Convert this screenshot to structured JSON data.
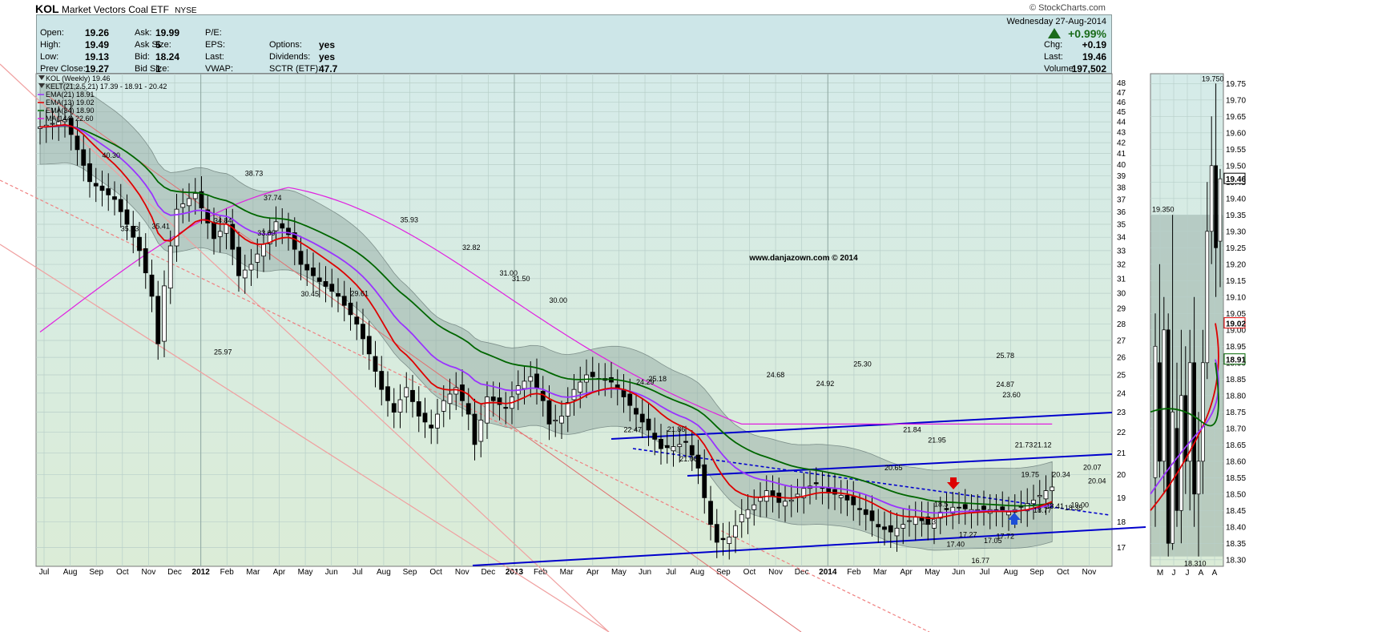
{
  "header": {
    "symbol": "KOL",
    "name": "Market Vectors Coal ETF",
    "exchange": "NYSE",
    "brand": "© StockCharts.com",
    "date": "Wednesday  27-Aug-2014",
    "change_pct": "+0.99%",
    "quote_left": [
      {
        "k": "Open:",
        "v": "19.26"
      },
      {
        "k": "High:",
        "v": "19.49"
      },
      {
        "k": "Low:",
        "v": "19.13"
      },
      {
        "k": "Prev Close:",
        "v": "19.27"
      }
    ],
    "quote_mid": [
      {
        "k": "Ask:",
        "v": "19.99"
      },
      {
        "k": "Ask Size:",
        "v": "5"
      },
      {
        "k": "Bid:",
        "v": "18.24"
      },
      {
        "k": "Bid Size:",
        "v": "1"
      }
    ],
    "quote_mid2": [
      {
        "k": "P/E:",
        "v": ""
      },
      {
        "k": "EPS:",
        "v": ""
      },
      {
        "k": "Last:",
        "v": ""
      },
      {
        "k": "VWAP:",
        "v": ""
      }
    ],
    "quote_right2": [
      {
        "k": "Options:",
        "v": "yes"
      },
      {
        "k": "Dividends:",
        "v": "yes"
      },
      {
        "k": "SCTR (ETF):",
        "v": "47.7"
      }
    ],
    "quote_right": [
      {
        "k": "Chg:",
        "v": "+0.19"
      },
      {
        "k": "Last:",
        "v": "19.46"
      },
      {
        "k": "Volume:",
        "v": "197,502"
      }
    ]
  },
  "legend": [
    {
      "text": "KOL (Weekly) 19.46",
      "color": "#000000"
    },
    {
      "text": "KELT(21,2.5,21) 17.39 - 18.91 - 20.42",
      "color": "#000000"
    },
    {
      "text": "EMA(21) 18.91",
      "color": "#9a33ff"
    },
    {
      "text": "EMA(13) 19.02",
      "color": "#dd0000"
    },
    {
      "text": "EMA(34) 18.90",
      "color": "#006600"
    },
    {
      "text": "MA(144) 22.60",
      "color": "#e020e0"
    }
  ],
  "watermark": "www.danjazown.com © 2014",
  "chart_data": [
    {
      "type": "candlestick",
      "title": "KOL (Weekly)",
      "y_scale": "log",
      "ylim": [
        16.3,
        49
      ],
      "y_ticks": [
        17,
        18,
        19,
        20,
        21,
        22,
        23,
        24,
        25,
        26,
        27,
        28,
        29,
        30,
        31,
        32,
        33,
        34,
        35,
        36,
        37,
        38,
        39,
        40,
        41,
        42,
        43,
        44,
        45,
        46,
        47,
        48
      ],
      "x_ticks": [
        "Jul",
        "Aug",
        "Sep",
        "Oct",
        "Nov",
        "Dec",
        "2012",
        "Feb",
        "Mar",
        "Apr",
        "May",
        "Jun",
        "Jul",
        "Aug",
        "Sep",
        "Oct",
        "Nov",
        "Dec",
        "2013",
        "Feb",
        "Mar",
        "Apr",
        "May",
        "Jun",
        "Jul",
        "Aug",
        "Sep",
        "Oct",
        "Nov",
        "Dec",
        "2014",
        "Feb",
        "Mar",
        "Apr",
        "May",
        "Jun",
        "Jul",
        "Aug",
        "Sep",
        "Oct",
        "Nov"
      ],
      "close_path": [
        [
          0,
          43.5
        ],
        [
          4,
          44.2
        ],
        [
          8,
          38.5
        ],
        [
          12,
          37.0
        ],
        [
          16,
          33.0
        ],
        [
          18,
          29.8
        ],
        [
          19,
          26.8
        ],
        [
          20,
          30.5
        ],
        [
          22,
          36.2
        ],
        [
          25,
          37.5
        ],
        [
          28,
          33.9
        ],
        [
          30,
          35.0
        ],
        [
          32,
          31.2
        ],
        [
          34,
          32.0
        ],
        [
          36,
          33.5
        ],
        [
          38,
          35.2
        ],
        [
          40,
          34.2
        ],
        [
          42,
          32.0
        ],
        [
          45,
          30.8
        ],
        [
          48,
          29.8
        ],
        [
          51,
          28.0
        ],
        [
          53,
          26.2
        ],
        [
          55,
          24.2
        ],
        [
          57,
          23.0
        ],
        [
          59,
          24.3
        ],
        [
          61,
          22.8
        ],
        [
          63,
          22.2
        ],
        [
          65,
          23.6
        ],
        [
          67,
          24.3
        ],
        [
          69,
          22.9
        ],
        [
          70,
          21.4
        ],
        [
          72,
          23.8
        ],
        [
          75,
          23.2
        ],
        [
          77,
          24.4
        ],
        [
          79,
          24.9
        ],
        [
          81,
          23.6
        ],
        [
          82,
          22.4
        ],
        [
          84,
          22.8
        ],
        [
          86,
          24.2
        ],
        [
          88,
          25.0
        ],
        [
          90,
          24.8
        ],
        [
          92,
          24.6
        ],
        [
          94,
          23.8
        ],
        [
          96,
          22.9
        ],
        [
          98,
          22.1
        ],
        [
          100,
          21.2
        ],
        [
          102,
          21.3
        ],
        [
          104,
          21.5
        ],
        [
          106,
          20.3
        ],
        [
          107,
          19.0
        ],
        [
          108,
          17.9
        ],
        [
          109,
          17.2
        ],
        [
          111,
          17.4
        ],
        [
          113,
          18.3
        ],
        [
          115,
          18.7
        ],
        [
          117,
          19.3
        ],
        [
          119,
          18.8
        ],
        [
          121,
          18.9
        ],
        [
          123,
          19.4
        ],
        [
          125,
          19.6
        ],
        [
          127,
          19.2
        ],
        [
          129,
          19.1
        ],
        [
          131,
          18.7
        ],
        [
          133,
          18.3
        ],
        [
          135,
          17.8
        ],
        [
          137,
          17.6
        ],
        [
          139,
          17.9
        ],
        [
          141,
          18.2
        ],
        [
          143,
          17.9
        ],
        [
          145,
          18.4
        ],
        [
          147,
          18.6
        ],
        [
          150,
          18.5
        ],
        [
          153,
          18.5
        ],
        [
          156,
          18.4
        ],
        [
          158,
          18.6
        ],
        [
          160,
          18.9
        ],
        [
          162,
          19.3
        ],
        [
          163,
          19.46
        ]
      ],
      "overlays": {
        "EMA(21)": 18.91,
        "EMA(13)": 19.02,
        "EMA(34)": 18.9,
        "MA(144)": 22.6,
        "KELT(21,2.5,21)": [
          17.39,
          18.91,
          20.42
        ]
      },
      "annotations": [
        "40.30",
        "35.23",
        "38.73",
        "37.74",
        "34.84",
        "35.41",
        "33.89",
        "30.45",
        "29.61",
        "35.93",
        "32.82",
        "31.50",
        "31.00",
        "30.00",
        "25.97",
        "25.18",
        "24.29",
        "22.47",
        "21.86",
        "21.06",
        "24.68",
        "24.92",
        "25.30",
        "20.65",
        "21.84",
        "21.95",
        "25.78",
        "24.87",
        "23.60",
        "21.73",
        "21.12",
        "20.34",
        "18.35",
        "19.00",
        "20.07",
        "20.04",
        "18.41",
        "18.77",
        "19.75",
        "17.72",
        "17.05",
        "16.77",
        "17.27",
        "17.40",
        "18.5",
        "18.3"
      ]
    },
    {
      "type": "candlestick",
      "title": "",
      "ylim": [
        18.28,
        19.78
      ],
      "y_ticks": [
        18.3,
        18.35,
        18.4,
        18.45,
        18.5,
        18.55,
        18.6,
        18.65,
        18.7,
        18.75,
        18.8,
        18.85,
        18.9,
        18.95,
        19.0,
        19.05,
        19.1,
        19.15,
        19.2,
        19.25,
        19.3,
        19.35,
        19.4,
        19.45,
        19.5,
        19.55,
        19.6,
        19.65,
        19.7,
        19.75
      ],
      "x_ticks": [
        "M",
        "J",
        "J",
        "A",
        "A"
      ],
      "annotations": [
        "19.750",
        "19.350",
        "18.310"
      ],
      "value_badges": [
        {
          "value": "19.46",
          "color": "#000000"
        },
        {
          "value": "19.02",
          "color": "#dd0000"
        },
        {
          "value": "18.91",
          "color": "#006600"
        }
      ]
    }
  ]
}
